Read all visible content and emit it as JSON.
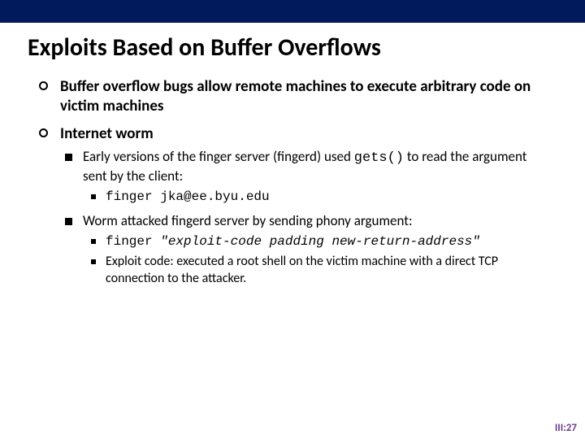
{
  "title": "Exploits Based on Buffer Overflows",
  "p1": "Buffer overflow bugs allow remote machines to execute arbitrary code on victim machines",
  "p2": "Internet worm",
  "s1a": "Early versions of the finger server (fingerd) used ",
  "s1b": "gets()",
  "s1c": " to read the argument sent by the client:",
  "s1cmd": "finger jka@ee.byu.edu",
  "s2": "Worm attacked fingerd server by sending phony argument:",
  "s2cmd_a": "finger ",
  "s2cmd_b": "\"exploit-code  padding  new-return-address\"",
  "s2exp": "Exploit code: executed a root shell on the victim machine with a direct TCP connection to the attacker.",
  "pagenum": "III:27"
}
